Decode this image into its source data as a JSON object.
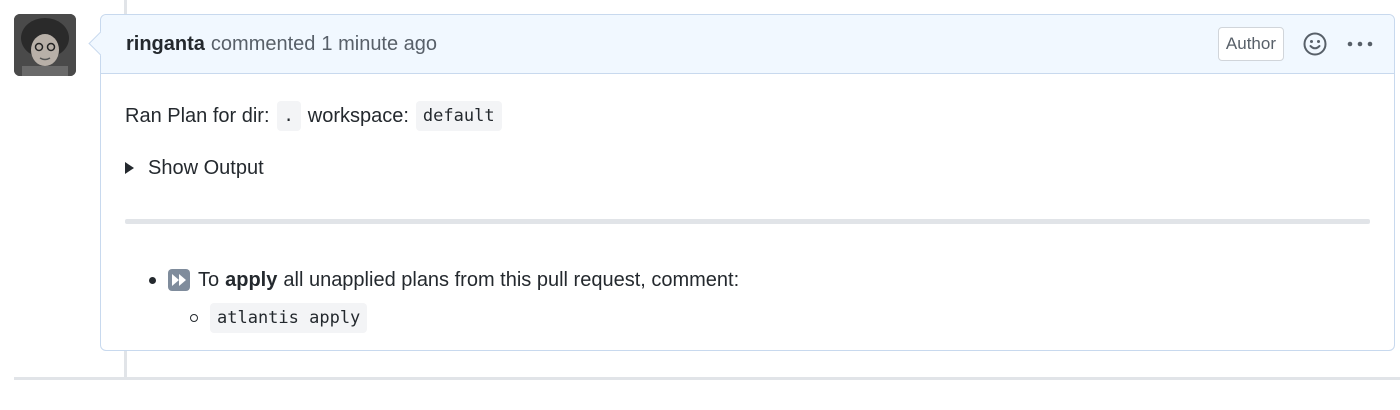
{
  "comment": {
    "author": "ringanta",
    "action": "commented",
    "timestamp": "1 minute ago",
    "badge": "Author",
    "icons": {
      "reaction": "smiley-icon",
      "more": "kebab-horizontal-icon"
    }
  },
  "body": {
    "line1": {
      "prefix": "Ran Plan for dir:",
      "dir": ".",
      "middle": "workspace:",
      "workspace": "default"
    },
    "details_summary": "Show Output",
    "list": {
      "item_prefix": "To",
      "item_bold": "apply",
      "item_suffix": "all unapplied plans from this pull request, comment:",
      "item_icon": "fast-forward-icon",
      "sub_item_code": "atlantis apply"
    }
  },
  "colors": {
    "header_bg": "#f1f8ff",
    "border": "#c8d9ee",
    "text": "#24292e",
    "muted": "#586069"
  }
}
